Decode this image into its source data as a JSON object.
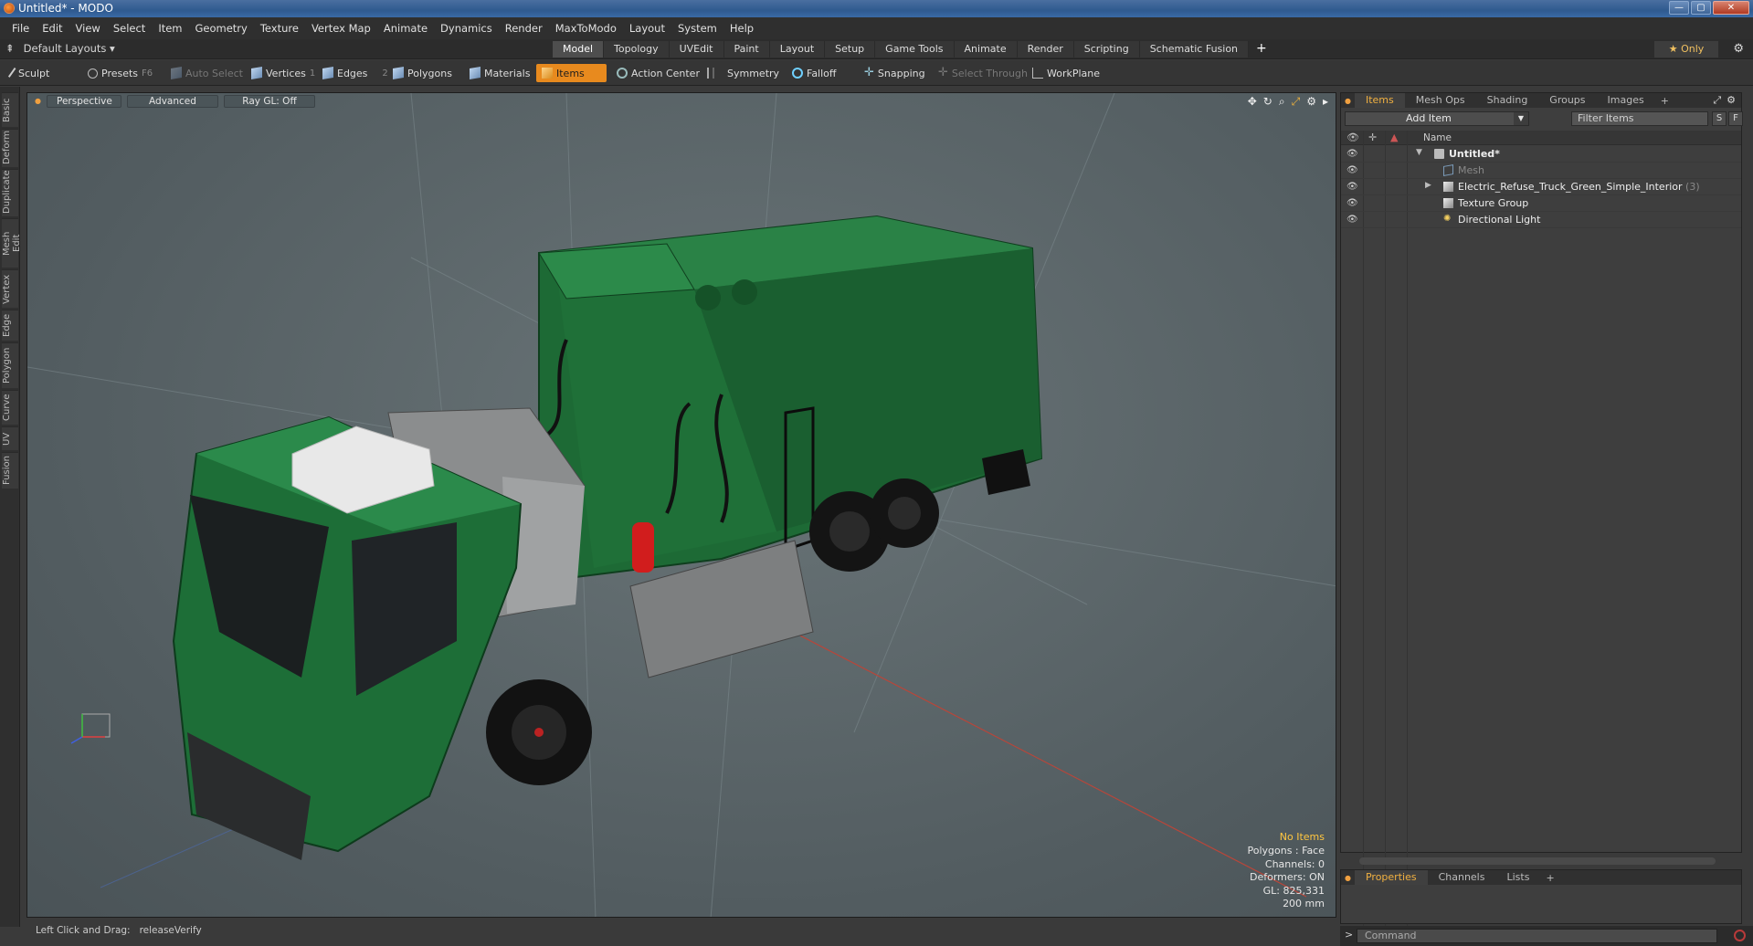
{
  "window": {
    "title": "Untitled* - MODO",
    "btn_min": "—",
    "btn_max": "▢",
    "btn_close": "✕"
  },
  "menu": [
    "File",
    "Edit",
    "View",
    "Select",
    "Item",
    "Geometry",
    "Texture",
    "Vertex Map",
    "Animate",
    "Dynamics",
    "Render",
    "MaxToModo",
    "Layout",
    "System",
    "Help"
  ],
  "layouts": {
    "arrow": "⇞",
    "selected": "Default Layouts"
  },
  "layout_tabs": [
    "Model",
    "Topology",
    "UVEdit",
    "Paint",
    "Layout",
    "Setup",
    "Game Tools",
    "Animate",
    "Render",
    "Scripting",
    "Schematic Fusion"
  ],
  "layout_add": "+",
  "only_label": "★  Only",
  "toolbar": {
    "sculpt": "Sculpt",
    "presets": "Presets",
    "presets_key": "F6",
    "auto_select": "Auto Select",
    "vertices": "Vertices",
    "vertices_key": "1",
    "edges": "Edges",
    "edges_key": "2",
    "polygons": "Polygons",
    "materials": "Materials",
    "items": "Items",
    "action_center": "Action Center",
    "symmetry": "Symmetry",
    "falloff": "Falloff",
    "snapping": "Snapping",
    "select_through": "Select Through",
    "workplane": "WorkPlane"
  },
  "left_tabs": [
    "Basic",
    "Deform",
    "Duplicate",
    "Mesh Edit",
    "Vertex",
    "Edge",
    "Polygon",
    "Curve",
    "UV",
    "Fusion"
  ],
  "viewport": {
    "perspective": "Perspective",
    "advanced": "Advanced",
    "raygl": "Ray GL: Off",
    "info": [
      "No Items",
      "Polygons : Face",
      "Channels: 0",
      "Deformers: ON",
      "GL: 825,331",
      "200 mm"
    ]
  },
  "status": {
    "left": "Left Click and Drag:",
    "right": "releaseVerify"
  },
  "items_panel": {
    "tabs": [
      "Items",
      "Mesh Ops",
      "Shading",
      "Groups",
      "Images"
    ],
    "add_item": "Add Item",
    "filter_placeholder": "Filter Items",
    "s_btn": "S",
    "f_btn": "F",
    "name_header": "Name",
    "tree": [
      {
        "label": "Untitled*",
        "icon": "scene-icon",
        "level": 0,
        "expanded": true
      },
      {
        "label": "Mesh",
        "icon": "mesh-icon",
        "level": 1,
        "dim": true
      },
      {
        "label": "Electric_Refuse_Truck_Green_Simple_Interior",
        "count": "(3)",
        "icon": "group-icon",
        "level": 1
      },
      {
        "label": "Texture Group",
        "icon": "texture-group-icon",
        "level": 1
      },
      {
        "label": "Directional Light",
        "icon": "light-icon",
        "level": 1
      }
    ]
  },
  "properties_panel": {
    "tabs": [
      "Properties",
      "Channels",
      "Lists"
    ]
  },
  "command": {
    "placeholder": "Command"
  },
  "colors": {
    "accent": "#e88a1e",
    "truck_green": "#1c6e37",
    "info_warn": "#ffc640"
  }
}
